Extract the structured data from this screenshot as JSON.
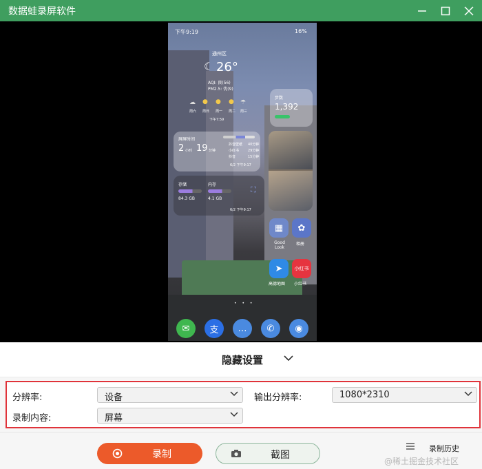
{
  "window": {
    "title": "数据蛙录屏软件"
  },
  "phone": {
    "status_time": "下午9:19",
    "battery": "16%",
    "weather": {
      "location": "通州区",
      "temp": "26°",
      "aqi": "AQI: 良(56)",
      "pm": "PM2.5: 优(9)",
      "days": [
        "周六",
        "周日",
        "周一",
        "周二",
        "周三"
      ],
      "updated": "下午7:59"
    },
    "steps": {
      "label": "步数",
      "value": "1,392"
    },
    "screen_time": {
      "label": "屏屏时间",
      "hours": "2",
      "hours_unit": "小时",
      "minutes": "19",
      "minutes_unit": "分钟",
      "apps": [
        {
          "name": "抖音壁纸",
          "time": "40分钟"
        },
        {
          "name": "小红书",
          "time": "29分钟"
        },
        {
          "name": "抖音",
          "time": "15分钟"
        }
      ],
      "updated": "6/2 下午9:17"
    },
    "storage": {
      "label": "存储",
      "value": "84.3 GB"
    },
    "memory": {
      "label": "内存",
      "value": "4.1 GB"
    },
    "storage_updated": "6/2 下午9:17",
    "apps": [
      {
        "label": "Good Look",
        "color": "#6f88c9"
      },
      {
        "label": "相册",
        "color": "#5b76c8"
      },
      {
        "label": "高德地图",
        "color": "#2f8ae5"
      },
      {
        "label": "小红书",
        "color": "#e6343f"
      }
    ],
    "app_glyphs": {
      "good_look": "▦",
      "gallery": "✿",
      "amap": "➤",
      "xhs": "小红书"
    },
    "dock": [
      {
        "name": "wechat",
        "color": "#3fb74f",
        "glyph": "✉"
      },
      {
        "name": "alipay",
        "color": "#2b6fe5",
        "glyph": "支"
      },
      {
        "name": "messages",
        "color": "#4a8ae0",
        "glyph": "…"
      },
      {
        "name": "phone",
        "color": "#4a8ae0",
        "glyph": "✆"
      },
      {
        "name": "camera",
        "color": "#4a8ae0",
        "glyph": "◉"
      }
    ]
  },
  "panel": {
    "hide_settings": "隐藏设置",
    "resolution_label": "分辨率:",
    "resolution_value": "设备",
    "output_resolution_label": "输出分辨率:",
    "output_resolution_value": "1080*2310",
    "content_label": "录制内容:",
    "content_value": "屏幕",
    "record_button": "录制",
    "screenshot_button": "截图",
    "history": "录制历史",
    "watermark": "@稀土掘金技术社区"
  }
}
